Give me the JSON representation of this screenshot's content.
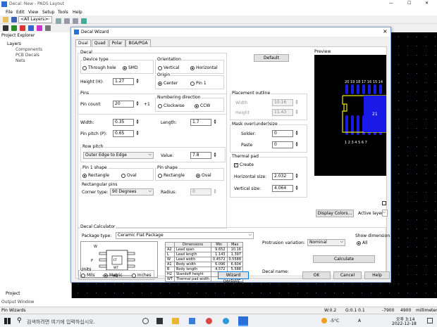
{
  "app": {
    "title": "Decal: New - PADS Layout"
  },
  "menu": [
    "File",
    "Edit",
    "View",
    "Setup",
    "Tools",
    "Help"
  ],
  "toolbar": {
    "layer_select": "<All Layers>"
  },
  "explorer": {
    "title": "Project Explorer",
    "items": [
      "Layers",
      "Components",
      "PCB Decals",
      "Nets"
    ],
    "bottom_tab": "Project"
  },
  "output_window": "Output Window",
  "dialog": {
    "title": "Decal Wizard",
    "close": "×",
    "tabs": [
      "Dual",
      "Quad",
      "Polar",
      "BGA/PGA"
    ],
    "default_btn": "Default",
    "decal": {
      "group": "Decal",
      "device_type": "Device type",
      "through_hole": "Through hole",
      "smd": "SMD",
      "orientation": "Orientation",
      "vertical": "Vertical",
      "horizontal": "Horizontal",
      "height_label": "Height (H):",
      "height_value": "1.27",
      "origin": "Origin",
      "center": "Center",
      "pin1": "Pin 1"
    },
    "pins": {
      "group": "Pins",
      "pin_count_label": "Pin count:",
      "pin_count_value": "20",
      "plus1": "+1",
      "numbering": "Numbering direction",
      "clockwise": "Clockwise",
      "ccw": "CCW",
      "width_label": "Width:",
      "width_value": "0.35",
      "length_label": "Length:",
      "length_value": "1.7",
      "pitch_label": "Pin pitch (P):",
      "pitch_value": "0.65",
      "row_pitch": "Row pitch",
      "row_pitch_select": "Outer Edge to Edge",
      "value_label": "Value:",
      "value_value": "7.8",
      "pin1_shape": "Pin 1 shape",
      "rectangle": "Rectangle",
      "oval": "Oval",
      "pin_shape": "Pin shape",
      "rect_pins": "Rectangular pins",
      "corner_type": "Corner type:",
      "corner_select": "90 Degrees",
      "radius_label": "Radius:",
      "radius_value": "0"
    },
    "placement": {
      "group": "Placement outline",
      "width_label": "Width",
      "width_value": "10.16",
      "height_label": "Height",
      "height_value": "11.43"
    },
    "mask": {
      "group": "Mask over(under)size",
      "solder_label": "Solder:",
      "solder_value": "0",
      "paste_label": "Paste",
      "paste_value": "0"
    },
    "thermal": {
      "group": "Thermal pad",
      "create": "Create",
      "hsize_label": "Horizontal size:",
      "hsize_value": "2.032",
      "vsize_label": "Vertical size:",
      "vsize_value": "4.064"
    },
    "preview": {
      "label": "Preview",
      "top_pins": "20 19 18 17 16 15 14",
      "bottom_pins": "1  2  3  4  5  6  7",
      "pad_label": "21",
      "display_colors": "Display Colors...",
      "active_layer": "Active layer:",
      "colors": {
        "pad": "#1a1ae6",
        "outline": "#e6e600"
      }
    },
    "calculator": {
      "group": "Decal Calculator",
      "package_label": "Package type:",
      "package_value": "Ceramic Flat Package",
      "protrusion_label": "Protrusion variation:",
      "protrusion_value": "Nominal",
      "show_dims": "Show dimension",
      "all": "All",
      "calculate": "Calculate",
      "decal_name": "Decal name:",
      "diagram_labels": {
        "w": "W",
        "p": "P",
        "lt": "LT",
        "wt": "WT",
        "a1": "A1"
      },
      "table_headers": [
        "",
        "Dimensions",
        "Min",
        "Max"
      ],
      "rows": [
        [
          "A2",
          "Lead span",
          "9.652",
          "10.16"
        ],
        [
          "L",
          "Lead length",
          "1.143",
          "1.397"
        ],
        [
          "W",
          "Lead width",
          "0.4572",
          "0.5588"
        ],
        [
          "A1",
          "Body width",
          "6.096",
          "6.604"
        ],
        [
          "B",
          "Body length",
          "4.572",
          "5.588"
        ],
        [
          "H2",
          "Standoff height",
          "1.27",
          ""
        ],
        [
          "WT",
          "Thermal pad width",
          "",
          "2.032"
        ]
      ]
    },
    "units": {
      "group": "Units",
      "mils": "Mils",
      "metric": "Metric",
      "inches": "Inches"
    },
    "wizard_options": "Wizard Options...",
    "ok": "OK",
    "cancel": "Cancel",
    "help": "Help"
  },
  "status": {
    "left": "Pin Wizards",
    "w": "W:0.2",
    "g": "G:0.1 0.1",
    "x": "-7900",
    "y": "4900",
    "units": "millimeters"
  },
  "taskbar": {
    "search": "검색하려면 여기에 입력하십시오.",
    "weather": "-5°C",
    "time": "오후 3:14",
    "date": "2022-12-18",
    "ime": "A"
  }
}
